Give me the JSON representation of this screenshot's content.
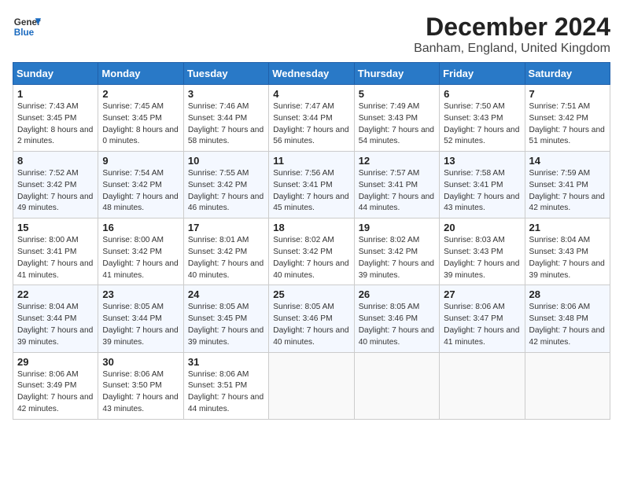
{
  "header": {
    "logo_line1": "General",
    "logo_line2": "Blue",
    "month": "December 2024",
    "location": "Banham, England, United Kingdom"
  },
  "weekdays": [
    "Sunday",
    "Monday",
    "Tuesday",
    "Wednesday",
    "Thursday",
    "Friday",
    "Saturday"
  ],
  "weeks": [
    [
      {
        "day": "1",
        "sunrise": "7:43 AM",
        "sunset": "3:45 PM",
        "daylight": "8 hours and 2 minutes."
      },
      {
        "day": "2",
        "sunrise": "7:45 AM",
        "sunset": "3:45 PM",
        "daylight": "8 hours and 0 minutes."
      },
      {
        "day": "3",
        "sunrise": "7:46 AM",
        "sunset": "3:44 PM",
        "daylight": "7 hours and 58 minutes."
      },
      {
        "day": "4",
        "sunrise": "7:47 AM",
        "sunset": "3:44 PM",
        "daylight": "7 hours and 56 minutes."
      },
      {
        "day": "5",
        "sunrise": "7:49 AM",
        "sunset": "3:43 PM",
        "daylight": "7 hours and 54 minutes."
      },
      {
        "day": "6",
        "sunrise": "7:50 AM",
        "sunset": "3:43 PM",
        "daylight": "7 hours and 52 minutes."
      },
      {
        "day": "7",
        "sunrise": "7:51 AM",
        "sunset": "3:42 PM",
        "daylight": "7 hours and 51 minutes."
      }
    ],
    [
      {
        "day": "8",
        "sunrise": "7:52 AM",
        "sunset": "3:42 PM",
        "daylight": "7 hours and 49 minutes."
      },
      {
        "day": "9",
        "sunrise": "7:54 AM",
        "sunset": "3:42 PM",
        "daylight": "7 hours and 48 minutes."
      },
      {
        "day": "10",
        "sunrise": "7:55 AM",
        "sunset": "3:42 PM",
        "daylight": "7 hours and 46 minutes."
      },
      {
        "day": "11",
        "sunrise": "7:56 AM",
        "sunset": "3:41 PM",
        "daylight": "7 hours and 45 minutes."
      },
      {
        "day": "12",
        "sunrise": "7:57 AM",
        "sunset": "3:41 PM",
        "daylight": "7 hours and 44 minutes."
      },
      {
        "day": "13",
        "sunrise": "7:58 AM",
        "sunset": "3:41 PM",
        "daylight": "7 hours and 43 minutes."
      },
      {
        "day": "14",
        "sunrise": "7:59 AM",
        "sunset": "3:41 PM",
        "daylight": "7 hours and 42 minutes."
      }
    ],
    [
      {
        "day": "15",
        "sunrise": "8:00 AM",
        "sunset": "3:41 PM",
        "daylight": "7 hours and 41 minutes."
      },
      {
        "day": "16",
        "sunrise": "8:00 AM",
        "sunset": "3:42 PM",
        "daylight": "7 hours and 41 minutes."
      },
      {
        "day": "17",
        "sunrise": "8:01 AM",
        "sunset": "3:42 PM",
        "daylight": "7 hours and 40 minutes."
      },
      {
        "day": "18",
        "sunrise": "8:02 AM",
        "sunset": "3:42 PM",
        "daylight": "7 hours and 40 minutes."
      },
      {
        "day": "19",
        "sunrise": "8:02 AM",
        "sunset": "3:42 PM",
        "daylight": "7 hours and 39 minutes."
      },
      {
        "day": "20",
        "sunrise": "8:03 AM",
        "sunset": "3:43 PM",
        "daylight": "7 hours and 39 minutes."
      },
      {
        "day": "21",
        "sunrise": "8:04 AM",
        "sunset": "3:43 PM",
        "daylight": "7 hours and 39 minutes."
      }
    ],
    [
      {
        "day": "22",
        "sunrise": "8:04 AM",
        "sunset": "3:44 PM",
        "daylight": "7 hours and 39 minutes."
      },
      {
        "day": "23",
        "sunrise": "8:05 AM",
        "sunset": "3:44 PM",
        "daylight": "7 hours and 39 minutes."
      },
      {
        "day": "24",
        "sunrise": "8:05 AM",
        "sunset": "3:45 PM",
        "daylight": "7 hours and 39 minutes."
      },
      {
        "day": "25",
        "sunrise": "8:05 AM",
        "sunset": "3:46 PM",
        "daylight": "7 hours and 40 minutes."
      },
      {
        "day": "26",
        "sunrise": "8:05 AM",
        "sunset": "3:46 PM",
        "daylight": "7 hours and 40 minutes."
      },
      {
        "day": "27",
        "sunrise": "8:06 AM",
        "sunset": "3:47 PM",
        "daylight": "7 hours and 41 minutes."
      },
      {
        "day": "28",
        "sunrise": "8:06 AM",
        "sunset": "3:48 PM",
        "daylight": "7 hours and 42 minutes."
      }
    ],
    [
      {
        "day": "29",
        "sunrise": "8:06 AM",
        "sunset": "3:49 PM",
        "daylight": "7 hours and 42 minutes."
      },
      {
        "day": "30",
        "sunrise": "8:06 AM",
        "sunset": "3:50 PM",
        "daylight": "7 hours and 43 minutes."
      },
      {
        "day": "31",
        "sunrise": "8:06 AM",
        "sunset": "3:51 PM",
        "daylight": "7 hours and 44 minutes."
      },
      null,
      null,
      null,
      null
    ]
  ]
}
